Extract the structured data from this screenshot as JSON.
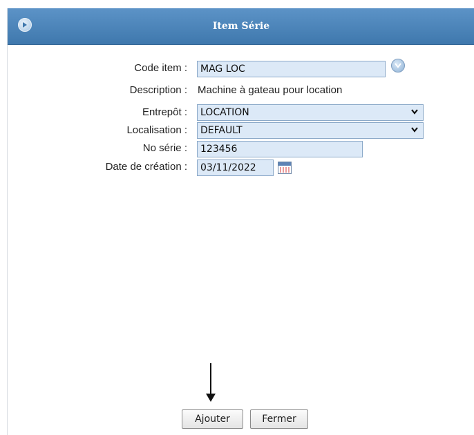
{
  "window": {
    "title": "Item Série",
    "icon": "collapse-circle-icon"
  },
  "form": {
    "code_item": {
      "label": "Code item :",
      "value": "MAG LOC"
    },
    "description": {
      "label": "Description :",
      "value": "Machine à gateau pour location"
    },
    "entrepot": {
      "label": "Entrepôt :",
      "value": "LOCATION"
    },
    "localisation": {
      "label": "Localisation :",
      "value": "DEFAULT"
    },
    "no_serie": {
      "label": "No série :",
      "value": "123456"
    },
    "date_creation": {
      "label": "Date de création :",
      "value": "03/11/2022"
    }
  },
  "buttons": {
    "add": "Ajouter",
    "close": "Fermer"
  },
  "colors": {
    "titlebar": "#4a84bb",
    "field_bg": "#dce9f7",
    "field_border": "#8aa8c8"
  }
}
